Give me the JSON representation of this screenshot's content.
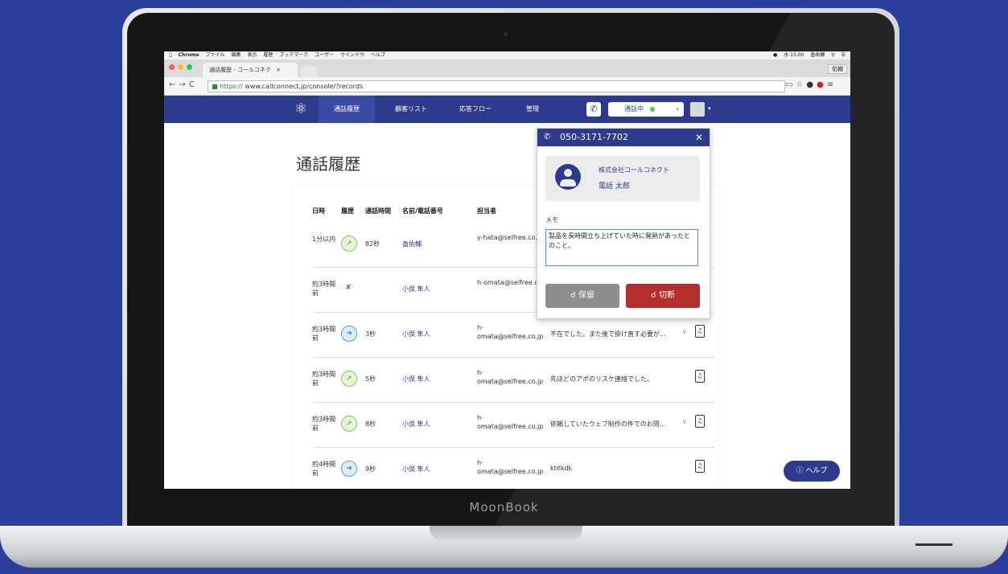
{
  "device": {
    "brand": "MoonBook"
  },
  "menubar": {
    "app": "Chrome",
    "items": [
      "ファイル",
      "編集",
      "表示",
      "履歴",
      "ブックマーク",
      "ユーザー",
      "ウインドウ",
      "ヘルプ"
    ],
    "clock": "水 15:00",
    "user": "畠佑輔"
  },
  "browser": {
    "tab_title": "通話履歴 - コールコネク",
    "profile": "佑輔",
    "url_scheme": "https://",
    "url_rest": " www.callconnect.jp/console/?records"
  },
  "nav": {
    "items": [
      "通話履歴",
      "顧客リスト",
      "応答フロー",
      "管理"
    ],
    "status": "通話中"
  },
  "page": {
    "title": "通話履歴"
  },
  "table": {
    "headers": [
      "日時",
      "履歴",
      "通話時間",
      "名前/電話番号",
      "担当者"
    ],
    "rows": [
      {
        "time": "1分以内",
        "type": "in",
        "duration": "82秒",
        "name": "畠佑輔",
        "agent": "y-hata@selfree.co.",
        "memo": "",
        "expand": false
      },
      {
        "time": "約3時間前",
        "type": "missed",
        "duration": "",
        "name": "小俣 隼人",
        "agent": "h-omata@selfree.co.j",
        "memo": "",
        "expand": false
      },
      {
        "time": "約3時間前",
        "type": "out",
        "duration": "3秒",
        "name": "小俣 隼人",
        "agent": "h-omata@selfree.co.jp",
        "memo": "不在でした。また後で掛け直す必要が...",
        "expand": true
      },
      {
        "time": "約3時間前",
        "type": "in",
        "duration": "5秒",
        "name": "小俣 隼人",
        "agent": "h-omata@selfree.co.jp",
        "memo": "先ほどのアポのリスケ連絡でした。",
        "expand": false
      },
      {
        "time": "約3時間前",
        "type": "in",
        "duration": "8秒",
        "name": "小俣 隼人",
        "agent": "h-omata@selfree.co.jp",
        "memo": "依頼していたウェブ制作の件でのお問...",
        "expand": true
      },
      {
        "time": "約4時間前",
        "type": "out",
        "duration": "9秒",
        "name": "小俣 隼人",
        "agent": "h-omata@selfree.co.jp",
        "memo": "khtkdk",
        "expand": false
      }
    ]
  },
  "call_popup": {
    "number": "050-3171-7702",
    "company": "株式会社コールコネクト",
    "contact_name": "電話 太郎",
    "memo_label": "メモ",
    "memo_text": "製品を長時間立ち上げていた時に発熱があったとのこと。",
    "hold_label": "保留",
    "hangup_label": "切断"
  },
  "help": {
    "label": "ヘルプ"
  },
  "colors": {
    "brand": "#2e3a8c",
    "background": "#2b3e9c",
    "hangup": "#b52e2e",
    "hold": "#8e8e8e",
    "online": "#4cc94c"
  }
}
